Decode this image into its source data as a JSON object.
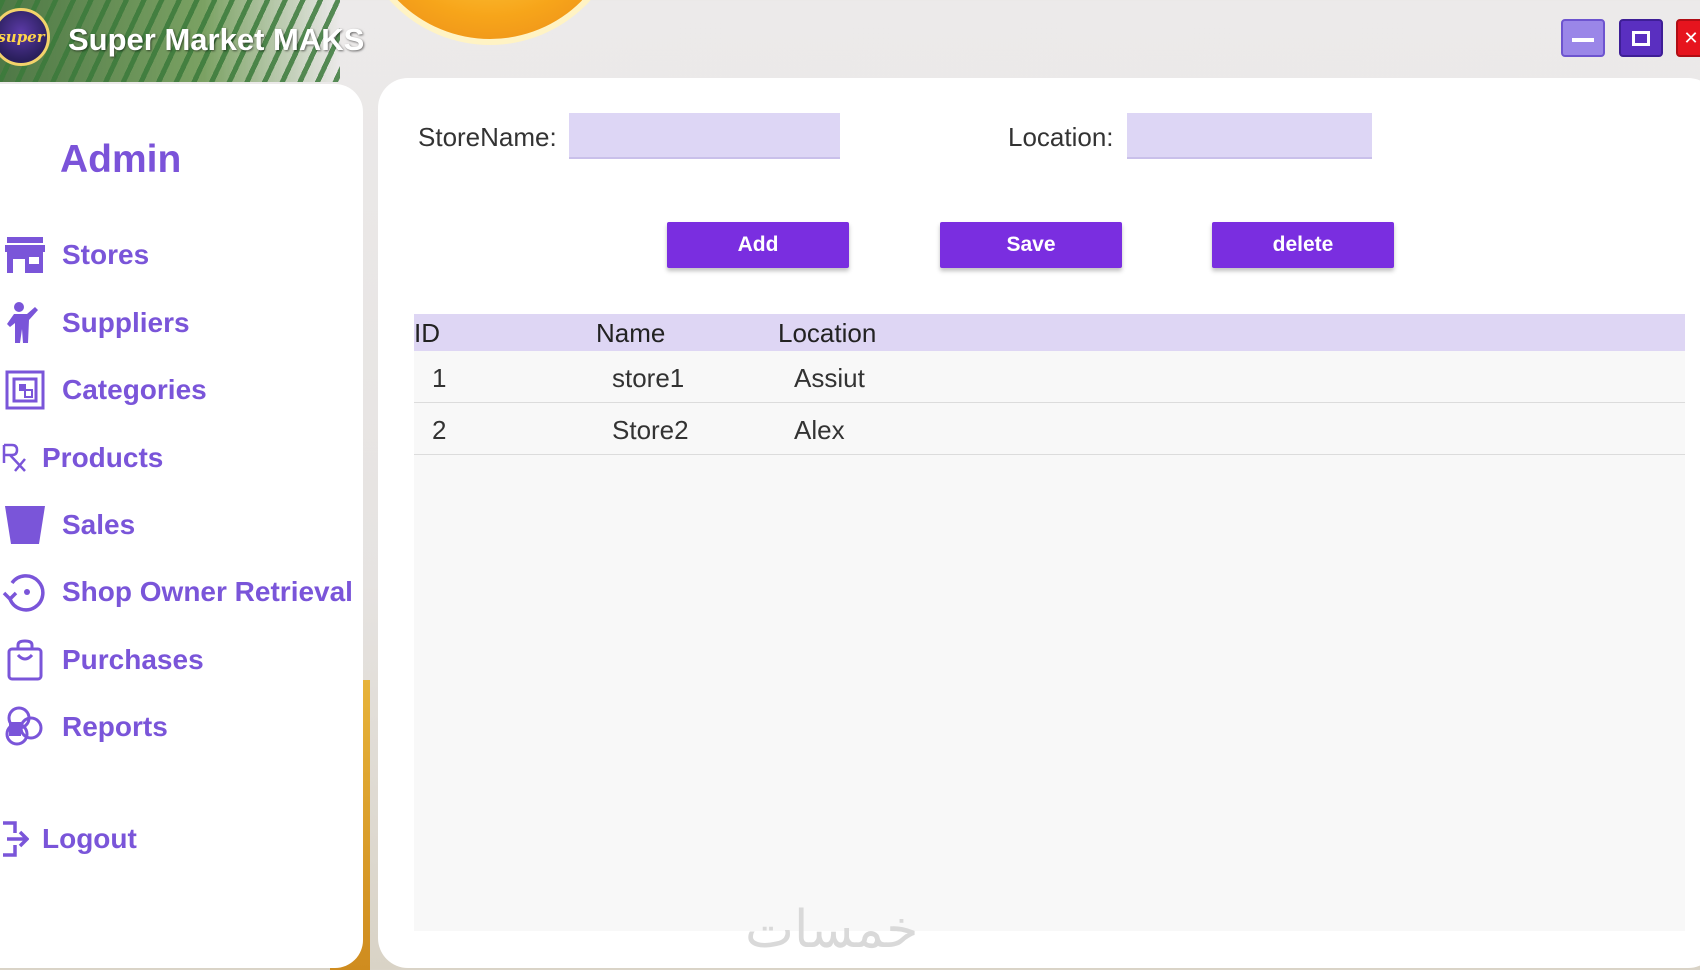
{
  "window": {
    "title": "Super Market MAKS",
    "logo_text": "super",
    "controls": {
      "minimize": "minimize-icon",
      "maximize": "maximize-icon",
      "close": "close-icon"
    }
  },
  "sidebar": {
    "role": "Admin",
    "items": [
      {
        "label": "Stores",
        "icon": "store-icon"
      },
      {
        "label": "Suppliers",
        "icon": "person-icon"
      },
      {
        "label": "Categories",
        "icon": "categories-icon"
      },
      {
        "label": "Products",
        "icon": "rx-icon"
      },
      {
        "label": "Sales",
        "icon": "cup-icon"
      },
      {
        "label": "Shop Owner Retrieval",
        "icon": "retrieval-icon"
      },
      {
        "label": "Purchases",
        "icon": "bag-icon"
      },
      {
        "label": "Reports",
        "icon": "reports-icon"
      }
    ],
    "logout": {
      "label": "Logout",
      "icon": "logout-icon"
    }
  },
  "form": {
    "store_name_label": "StoreName:",
    "store_name_value": "",
    "location_label": "Location:",
    "location_value": ""
  },
  "actions": {
    "add": "Add",
    "save": "Save",
    "delete": "delete"
  },
  "table": {
    "columns": [
      "ID",
      "Name",
      "Location"
    ],
    "rows": [
      [
        "1",
        "store1",
        "Assiut"
      ],
      [
        "2",
        "Store2",
        "Alex"
      ]
    ]
  },
  "watermark": "خمسات",
  "colors": {
    "accent": "#7a2ee0",
    "nav_text": "#7a55d9",
    "input_bg": "#ddd6f5",
    "header_bg": "#ded6f4"
  }
}
